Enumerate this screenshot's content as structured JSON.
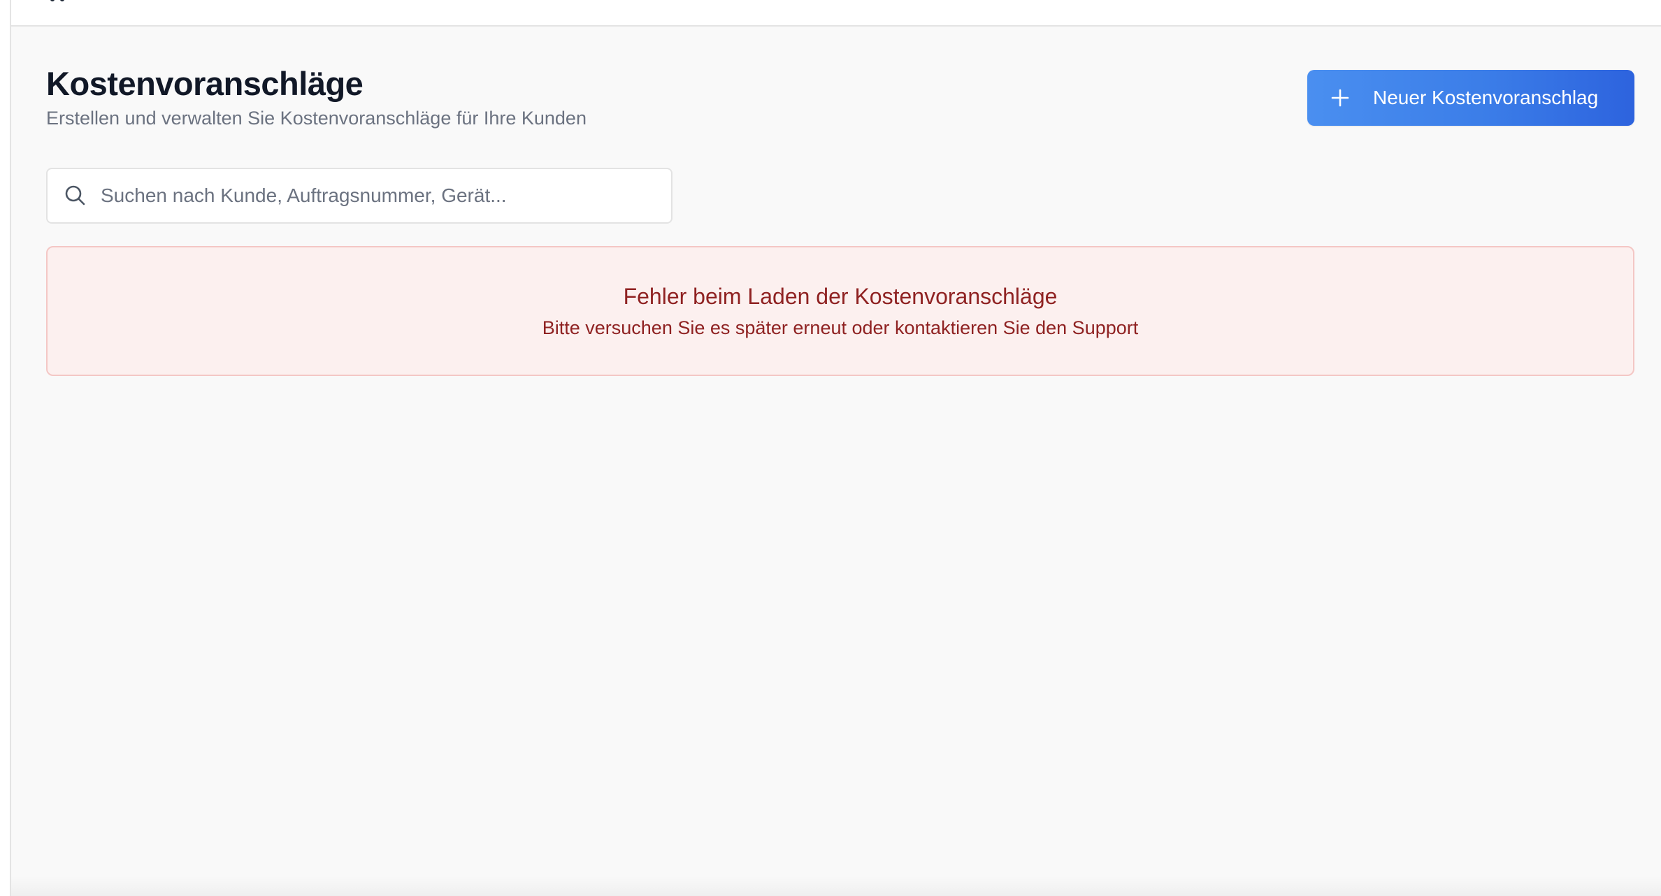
{
  "header": {
    "title": "Kostenvoranschläge",
    "subtitle": "Erstellen und verwalten Sie Kostenvoranschläge für Ihre Kunden"
  },
  "actions": {
    "new_label": "Neuer Kostenvoranschlag",
    "new_icon": "plus-icon"
  },
  "search": {
    "placeholder": "Suchen nach Kunde, Auftragsnummer, Gerät...",
    "value": "",
    "icon": "search-icon"
  },
  "error": {
    "title": "Fehler beim Laden der Kostenvoranschläge",
    "message": "Bitte versuchen Sie es später erneut oder kontaktieren Sie den Support"
  },
  "colors": {
    "primary": "#3b7de8",
    "error_text": "#8f2222",
    "error_background": "#fcf0ef",
    "error_border": "#f4c7c5",
    "title_text": "#111827",
    "muted_text": "#6b7280"
  }
}
